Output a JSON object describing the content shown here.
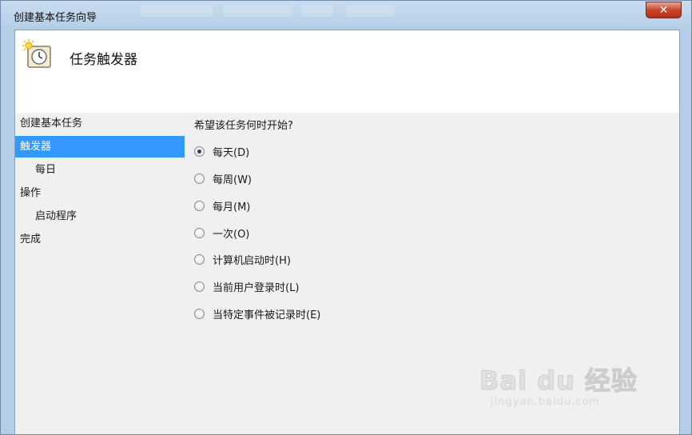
{
  "window": {
    "title": "创建基本任务向导",
    "close_label": "✕"
  },
  "header": {
    "title": "任务触发器",
    "icon": "task-clock-icon"
  },
  "steps": [
    {
      "label": "创建基本任务",
      "level": 0,
      "active": false
    },
    {
      "label": "触发器",
      "level": 0,
      "active": true
    },
    {
      "label": "每日",
      "level": 1,
      "active": false
    },
    {
      "label": "操作",
      "level": 0,
      "active": false
    },
    {
      "label": "启动程序",
      "level": 1,
      "active": false
    },
    {
      "label": "完成",
      "level": 0,
      "active": false
    }
  ],
  "main": {
    "question": "希望该任务何时开始?",
    "options": [
      {
        "label": "每天(D)",
        "checked": true
      },
      {
        "label": "每周(W)",
        "checked": false
      },
      {
        "label": "每月(M)",
        "checked": false
      },
      {
        "label": "一次(O)",
        "checked": false
      },
      {
        "label": "计算机启动时(H)",
        "checked": false
      },
      {
        "label": "当前用户登录时(L)",
        "checked": false
      },
      {
        "label": "当特定事件被记录时(E)",
        "checked": false
      }
    ]
  },
  "watermark": {
    "brand": "Bai du 经验",
    "url": "jingyan.baidu.com"
  },
  "colors": {
    "selection": "#3399ff",
    "client_bg": "#f0f0f0",
    "close_red": "#c8442b"
  }
}
